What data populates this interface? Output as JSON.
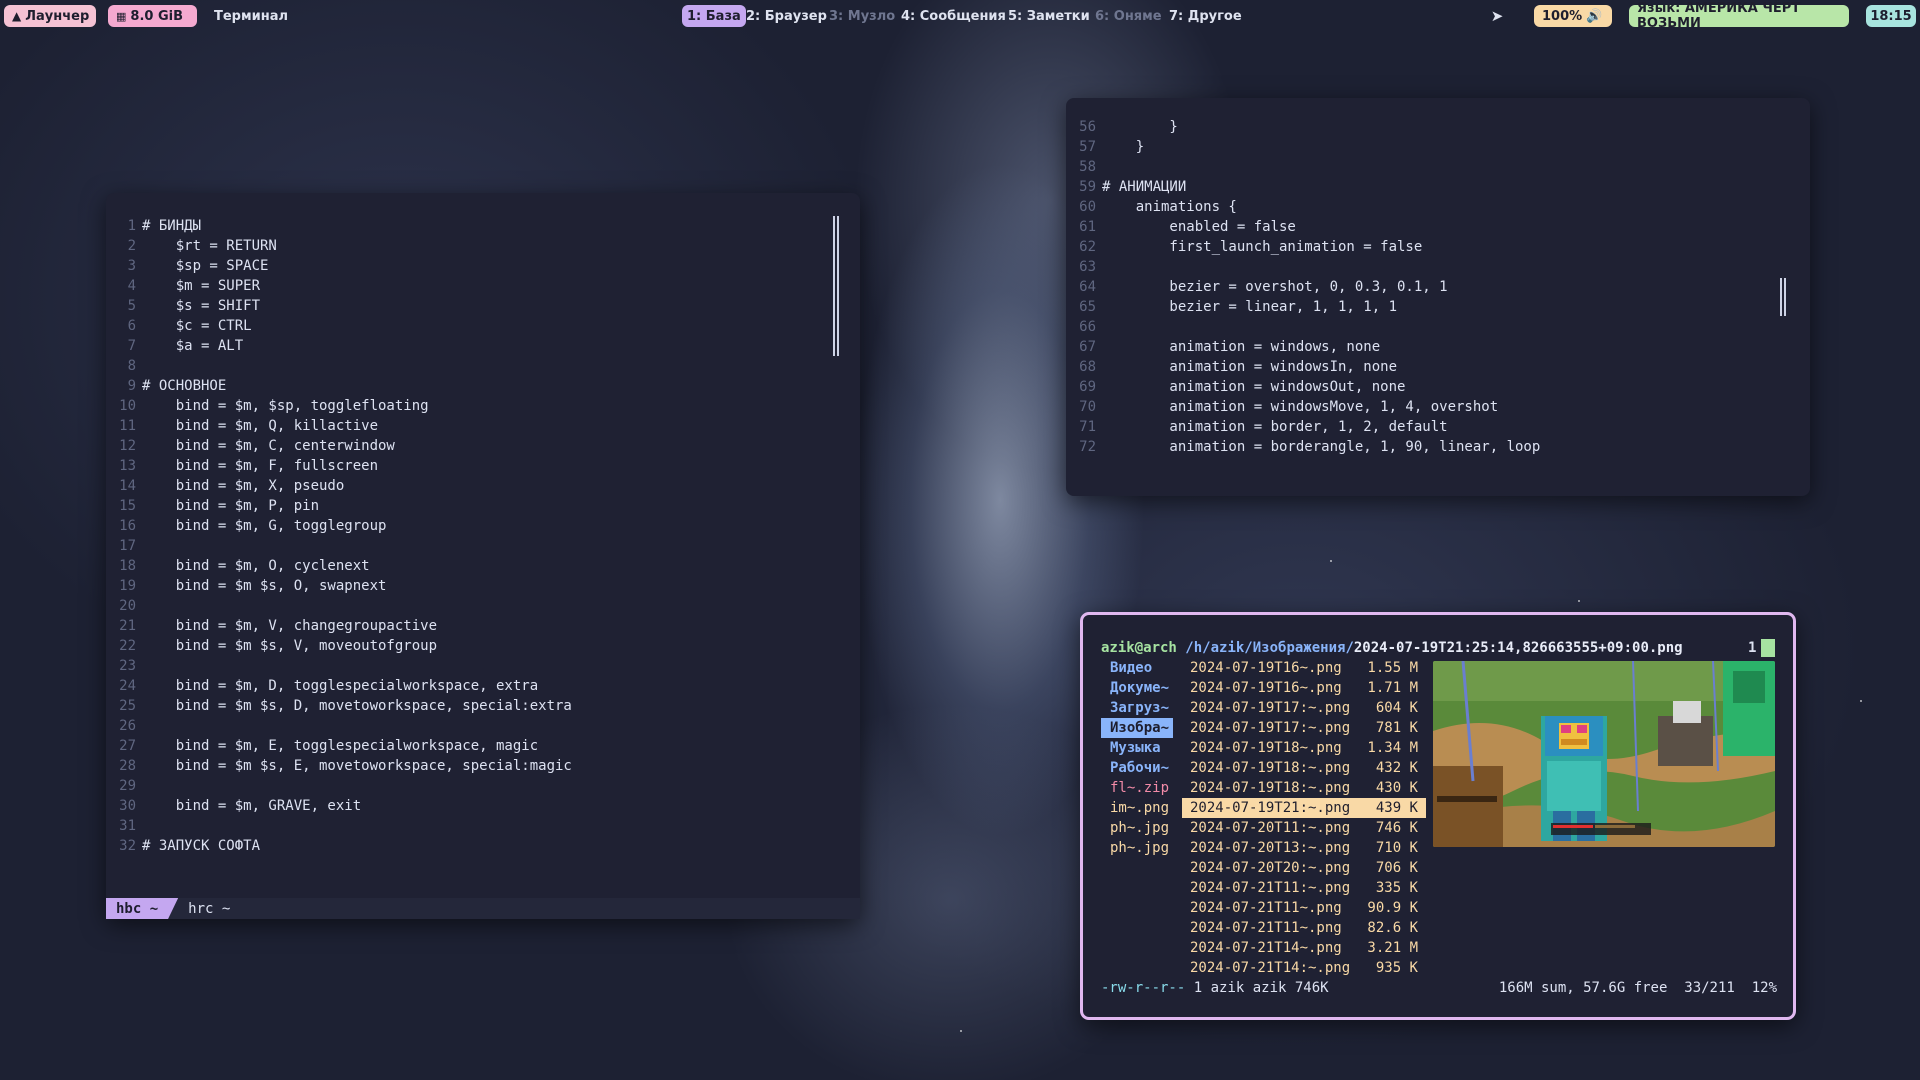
{
  "topbar": {
    "launcher": "Лаунчер",
    "memory": "8.0 GiB",
    "window_title": "Терминал",
    "workspaces": [
      {
        "label": "1: База",
        "state": "active"
      },
      {
        "label": "2: Браузер",
        "state": "normal"
      },
      {
        "label": "3: Музло",
        "state": "dim"
      },
      {
        "label": "4: Сообщения",
        "state": "normal"
      },
      {
        "label": "5: Заметки",
        "state": "normal"
      },
      {
        "label": "6: Оняме",
        "state": "dim"
      },
      {
        "label": "7: Другое",
        "state": "normal"
      }
    ],
    "volume": "100%",
    "language": "Язык: АМЕРИКА ЧЁРТ ВОЗЬМИ",
    "time": "18:15"
  },
  "editor_left": {
    "lines": [
      {
        "n": "1",
        "t": "# БИНДЫ"
      },
      {
        "n": "2",
        "t": "    $rt = RETURN"
      },
      {
        "n": "3",
        "t": "    $sp = SPACE"
      },
      {
        "n": "4",
        "t": "    $m = SUPER"
      },
      {
        "n": "5",
        "t": "    $s = SHIFT"
      },
      {
        "n": "6",
        "t": "    $c = CTRL"
      },
      {
        "n": "7",
        "t": "    $a = ALT"
      },
      {
        "n": "8",
        "t": ""
      },
      {
        "n": "9",
        "t": "# ОСНОВНОЕ"
      },
      {
        "n": "10",
        "t": "    bind = $m, $sp, togglefloating"
      },
      {
        "n": "11",
        "t": "    bind = $m, Q, killactive"
      },
      {
        "n": "12",
        "t": "    bind = $m, C, centerwindow"
      },
      {
        "n": "13",
        "t": "    bind = $m, F, fullscreen"
      },
      {
        "n": "14",
        "t": "    bind = $m, X, pseudo"
      },
      {
        "n": "15",
        "t": "    bind = $m, P, pin"
      },
      {
        "n": "16",
        "t": "    bind = $m, G, togglegroup"
      },
      {
        "n": "17",
        "t": ""
      },
      {
        "n": "18",
        "t": "    bind = $m, O, cyclenext"
      },
      {
        "n": "19",
        "t": "    bind = $m $s, O, swapnext"
      },
      {
        "n": "20",
        "t": ""
      },
      {
        "n": "21",
        "t": "    bind = $m, V, changegroupactive"
      },
      {
        "n": "22",
        "t": "    bind = $m $s, V, moveoutofgroup"
      },
      {
        "n": "23",
        "t": ""
      },
      {
        "n": "24",
        "t": "    bind = $m, D, togglespecialworkspace, extra"
      },
      {
        "n": "25",
        "t": "    bind = $m $s, D, movetoworkspace, special:extra"
      },
      {
        "n": "26",
        "t": ""
      },
      {
        "n": "27",
        "t": "    bind = $m, E, togglespecialworkspace, magic"
      },
      {
        "n": "28",
        "t": "    bind = $m $s, E, movetoworkspace, special:magic"
      },
      {
        "n": "29",
        "t": ""
      },
      {
        "n": "30",
        "t": "    bind = $m, GRAVE, exit"
      },
      {
        "n": "31",
        "t": ""
      },
      {
        "n": "32",
        "t": "# ЗАПУСК СОФТА"
      }
    ],
    "tabs": [
      "hbc ~",
      "hrc ~"
    ]
  },
  "editor_right": {
    "lines": [
      {
        "n": "56",
        "t": "        }"
      },
      {
        "n": "57",
        "t": "    }"
      },
      {
        "n": "58",
        "t": ""
      },
      {
        "n": "59",
        "t": "# АНИМАЦИИ"
      },
      {
        "n": "60",
        "t": "    animations {"
      },
      {
        "n": "61",
        "t": "        enabled = false"
      },
      {
        "n": "62",
        "t": "        first_launch_animation = false"
      },
      {
        "n": "63",
        "t": ""
      },
      {
        "n": "64",
        "t": "        bezier = overshot, 0, 0.3, 0.1, 1"
      },
      {
        "n": "65",
        "t": "        bezier = linear, 1, 1, 1, 1"
      },
      {
        "n": "66",
        "t": ""
      },
      {
        "n": "67",
        "t": "        animation = windows, none"
      },
      {
        "n": "68",
        "t": "        animation = windowsIn, none"
      },
      {
        "n": "69",
        "t": "        animation = windowsOut, none"
      },
      {
        "n": "70",
        "t": "        animation = windowsMove, 1, 4, overshot"
      },
      {
        "n": "71",
        "t": "        animation = border, 1, 2, default"
      },
      {
        "n": "72",
        "t": "        animation = borderangle, 1, 90, linear, loop"
      }
    ]
  },
  "file_manager": {
    "user": "azik@arch",
    "path": "/h/azik/Изображения/",
    "current_file": "2024-07-19T21:25:14,826663555+09:00.png",
    "tab_count": "1",
    "parent_entries": [
      {
        "name": "Видео",
        "kind": "dir"
      },
      {
        "name": "Докуме~",
        "kind": "dir"
      },
      {
        "name": "Загруз~",
        "kind": "dir"
      },
      {
        "name": "Изобра~",
        "kind": "dir-selected"
      },
      {
        "name": "Музыка",
        "kind": "dir"
      },
      {
        "name": "Рабочи~",
        "kind": "dir"
      },
      {
        "name": "fl~.zip",
        "kind": "zip"
      },
      {
        "name": "im~.png",
        "kind": "img"
      },
      {
        "name": "ph~.jpg",
        "kind": "img"
      },
      {
        "name": "ph~.jpg",
        "kind": "img"
      }
    ],
    "files": [
      {
        "name": "2024-07-19T16~.png",
        "size": "1.55 M"
      },
      {
        "name": "2024-07-19T16~.png",
        "size": "1.71 M"
      },
      {
        "name": "2024-07-19T17:~.png",
        "size": "604 K"
      },
      {
        "name": "2024-07-19T17:~.png",
        "size": "781 K"
      },
      {
        "name": "2024-07-19T18~.png",
        "size": "1.34 M"
      },
      {
        "name": "2024-07-19T18:~.png",
        "size": "432 K"
      },
      {
        "name": "2024-07-19T18:~.png",
        "size": "430 K"
      },
      {
        "name": "2024-07-19T21:~.png",
        "size": "439 K",
        "selected": true
      },
      {
        "name": "2024-07-20T11:~.png",
        "size": "746 K"
      },
      {
        "name": "2024-07-20T13:~.png",
        "size": "710 K"
      },
      {
        "name": "2024-07-20T20:~.png",
        "size": "706 K"
      },
      {
        "name": "2024-07-21T11:~.png",
        "size": "335 K"
      },
      {
        "name": "2024-07-21T11~.png",
        "size": "90.9 K"
      },
      {
        "name": "2024-07-21T11~.png",
        "size": "82.6 K"
      },
      {
        "name": "2024-07-21T14~.png",
        "size": "3.21 M"
      },
      {
        "name": "2024-07-21T14:~.png",
        "size": "935 K"
      }
    ],
    "footer_left_perm": "-rw-r--r--",
    "footer_left_rest": " 1 azik azik 746K",
    "footer_right": "166M sum, 57.6G free  33/211  12%"
  }
}
